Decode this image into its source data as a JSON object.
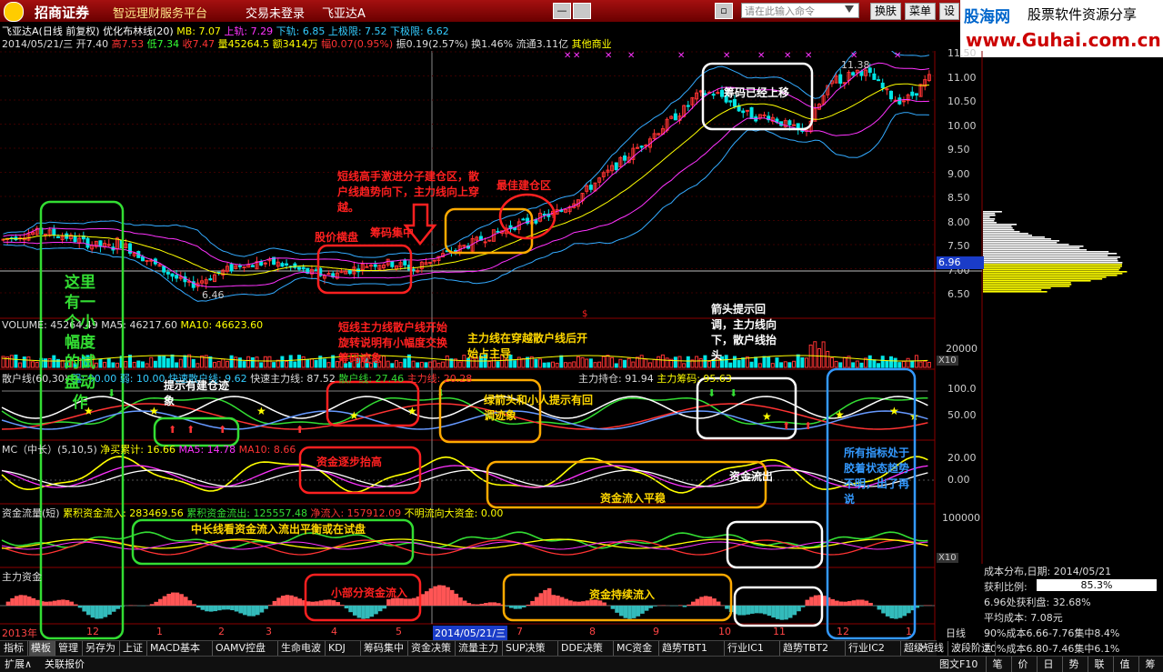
{
  "titlebar": {
    "brand": "招商证券",
    "platform": "智远理财服务平台",
    "login": "交易未登录",
    "stock": "飞亚达A",
    "search_placeholder": "请在此输入命令",
    "switch_label": "换肤",
    "menu_label": "菜单",
    "settings_label": "设",
    "win_buttons": [
      "▫",
      "▭",
      "—"
    ]
  },
  "ad": {
    "line1": "股海网",
    "line2": "股票软件资源分享",
    "line3": "www.Guhai.com.cn"
  },
  "info": {
    "name": "飞亚达A(日线 前复权)",
    "indicator": "优化布林线(20)",
    "mb": "MB: 7.07",
    "up": "上轨: 7.29",
    "down": "下轨: 6.85",
    "uplimit": "上极限: 7.52",
    "downlimit": "下极限: 6.62",
    "line2_date": "2014/05/21/三",
    "open": "开7.40",
    "high": "高7.53",
    "low": "低7.34",
    "close": "收7.47",
    "vol": "量45264.5",
    "amt": "额3414万",
    "chg": "幅0.07(0.95%)",
    "amp": "振0.19(2.57%)",
    "turn": "换1.46%",
    "float": "流通3.11亿",
    "sector": "其他商业"
  },
  "price_axis": [
    "11.50",
    "11.00",
    "10.50",
    "10.00",
    "9.50",
    "9.00",
    "8.50",
    "8.00",
    "7.50",
    "7.00",
    "6.50"
  ],
  "price_current": "6.96",
  "price_labels": {
    "high": "11.38",
    "low": "6.46"
  },
  "volume": {
    "label": "VOLUME: 45264.49",
    "ma5": "MA5: 46217.60",
    "ma10": "MA10: 46623.60",
    "axis": "20000",
    "x10": "X10"
  },
  "sanhu": {
    "label": "散户线(60,30)",
    "strong": "强: 90.00",
    "weak": "弱: 10.00",
    "fast_sanhu": "快速散户线: 9.62",
    "fast_main": "快速主力线: 87.52",
    "sanhu_line": "散户线: 27.46",
    "main_line": "主力线: 20.28",
    "hold": "主力持仓: 91.94",
    "chip": "主力筹码: 95.63",
    "axis": [
      "100.0",
      "50.00"
    ]
  },
  "mc": {
    "label": "MC（中长）(5,10,5)",
    "net": "净买累计: 16.66",
    "ma5": "MA5: 14.78",
    "ma10": "MA10: 8.66",
    "axis": [
      "20.00",
      "0.00"
    ]
  },
  "flow": {
    "label": "资金流量(短)",
    "in": "累积资金流入: 283469.56",
    "out": "累积资金流出: 125557.48",
    "net": "净流入: 157912.09",
    "unknown": "不明流向大资金: 0.00",
    "axis": "100000",
    "x10": "X10"
  },
  "main_fund": {
    "label": "主力资金"
  },
  "xaxis": [
    "2013年",
    "12",
    "1",
    "2",
    "3",
    "4",
    "5",
    "2014/05/21/三",
    "7",
    "8",
    "9",
    "10",
    "11",
    "12",
    "1"
  ],
  "xaxis_right": "日线",
  "annotations": {
    "green_left": "这里有一个小幅度的试盘动作",
    "short_high": "短线高手激进分子建仓区，散户线趋势向下，主力线向上穿越。",
    "best": "最佳建仓区",
    "price_consol": "股价横盘",
    "chip_conc": "筹码集中",
    "chip_up": "筹码已经上移",
    "short_main": "短线主力线散户线开始旋转说明有小幅度交换筹码迹象",
    "main_cross": "主力线在穿越散户线后开始占主导",
    "hint_build": "提示有建仓迹象",
    "arrow_hint": "箭头提示回调，主力线向下，散户线抬头",
    "green_arrow": "绿箭头和小人提示有回调迹象",
    "fund_up": "资金逐步抬高",
    "fund_stable": "资金流入平稳",
    "fund_out": "资金流出",
    "all_ind": "所有指标处于胶着状态趋势不明，出了再说",
    "mid_long": "中长线看资金流入流出平衡或在试盘",
    "small_in": "小部分资金流入",
    "cont_in": "资金持续流入"
  },
  "tabs": [
    "指标",
    "模板",
    "管理",
    "另存为",
    "上证",
    "MACD基本",
    "OAMV控盘",
    "生命电波",
    "KDJ",
    "筹码集中",
    "资金决策",
    "流量主力",
    "SUP决策",
    "DDE决策",
    "MC资金",
    "趋势TBT1",
    "行业IC1",
    "趋势TBT2",
    "行业IC2",
    "超级短线",
    "波段阶运"
  ],
  "bottom": {
    "expand": "扩展∧",
    "related": "关联报价",
    "code": "图文F10",
    "btns": [
      "笔",
      "价",
      "日",
      "势",
      "联",
      "值",
      "筹"
    ]
  },
  "right_panel": {
    "title": "成本分布,日期: 2014/05/21",
    "profit_label": "获利比例:",
    "profit_value": "85.3%",
    "p1": "6.96处获利盘: 32.68%",
    "p2": "平均成本: 7.08元",
    "p3": "90%成本6.66-7.76集中8.4%",
    "p4": "70%成本6.80-7.46集中6.1%"
  },
  "colors": {
    "up": "#ff3333",
    "down": "#00e5e5",
    "boll": "#33aaff",
    "mid": "#ffffff",
    "yellow": "#ffff00",
    "magenta": "#ff33ff",
    "green": "#33dd33"
  }
}
